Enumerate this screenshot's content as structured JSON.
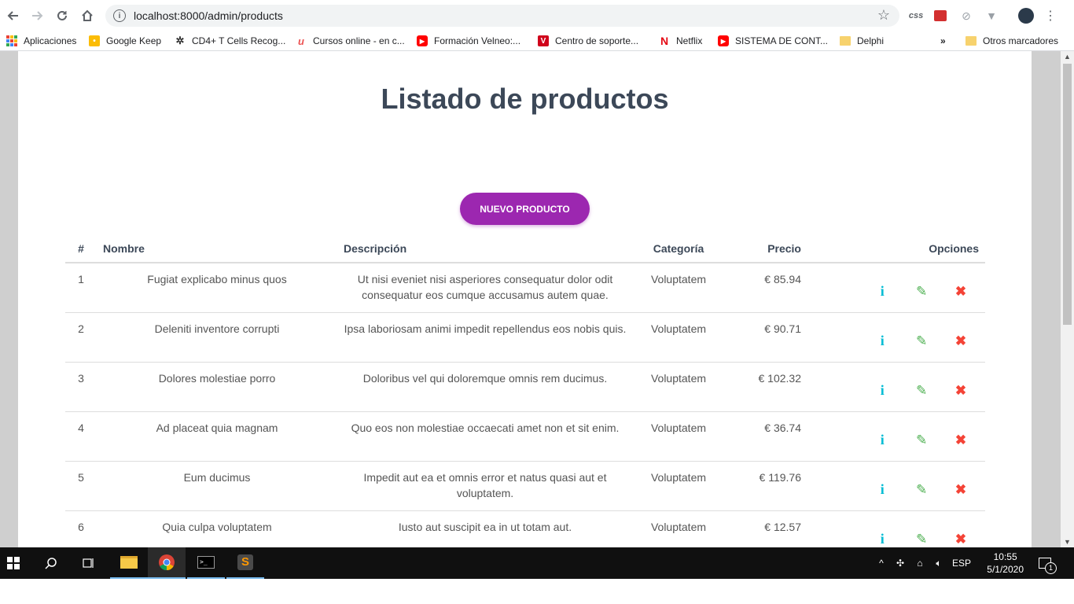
{
  "browser": {
    "url": "localhost:8000/admin/products",
    "extensions": {
      "css_label": "css"
    },
    "bookmarks": [
      {
        "label": "Aplicaciones",
        "icon": "apps-grid-icon"
      },
      {
        "label": "Google Keep",
        "icon": "google-keep-icon"
      },
      {
        "label": "CD4+ T Cells Recog...",
        "icon": "virus-icon"
      },
      {
        "label": "Cursos online - en c...",
        "icon": "udemy-icon"
      },
      {
        "label": "Formación Velneo:...",
        "icon": "youtube-icon"
      },
      {
        "label": "Centro de soporte...",
        "icon": "velneo-icon"
      },
      {
        "label": "Netflix",
        "icon": "netflix-icon"
      },
      {
        "label": "SISTEMA DE CONT...",
        "icon": "youtube-icon"
      },
      {
        "label": "Delphi",
        "icon": "folder-icon"
      }
    ],
    "overflow_label": "»",
    "other_bookmarks": "Otros marcadores"
  },
  "page": {
    "title": "Listado de productos",
    "new_button": "NUEVO PRODUCTO",
    "columns": {
      "num": "#",
      "name": "Nombre",
      "description": "Descripción",
      "category": "Categoría",
      "price": "Precio",
      "options": "Opciones"
    },
    "products": [
      {
        "id": "1",
        "name": "Fugiat explicabo minus quos",
        "description": "Ut nisi eveniet nisi asperiores consequatur dolor odit consequatur eos cumque accusamus autem quae.",
        "category": "Voluptatem",
        "price": "€ 85.94"
      },
      {
        "id": "2",
        "name": "Deleniti inventore corrupti",
        "description": "Ipsa laboriosam animi impedit repellendus eos nobis quis.",
        "category": "Voluptatem",
        "price": "€ 90.71"
      },
      {
        "id": "3",
        "name": "Dolores molestiae porro",
        "description": "Doloribus vel qui doloremque omnis rem ducimus.",
        "category": "Voluptatem",
        "price": "€ 102.32"
      },
      {
        "id": "4",
        "name": "Ad placeat quia magnam",
        "description": "Quo eos non molestiae occaecati amet non et sit enim.",
        "category": "Voluptatem",
        "price": "€ 36.74"
      },
      {
        "id": "5",
        "name": "Eum ducimus",
        "description": "Impedit aut ea et omnis error et natus quasi aut et voluptatem.",
        "category": "Voluptatem",
        "price": "€ 119.76"
      },
      {
        "id": "6",
        "name": "Quia culpa voluptatem",
        "description": "Iusto aut suscipit ea in ut totam aut.",
        "category": "Voluptatem",
        "price": "€ 12.57"
      }
    ],
    "accent_color": "#9c27b0",
    "icon_colors": {
      "info": "#00bcd4",
      "edit": "#4caf50",
      "delete": "#f44336"
    }
  },
  "taskbar": {
    "language": "ESP",
    "time": "10:55",
    "date": "5/1/2020",
    "notification_count": "1"
  }
}
